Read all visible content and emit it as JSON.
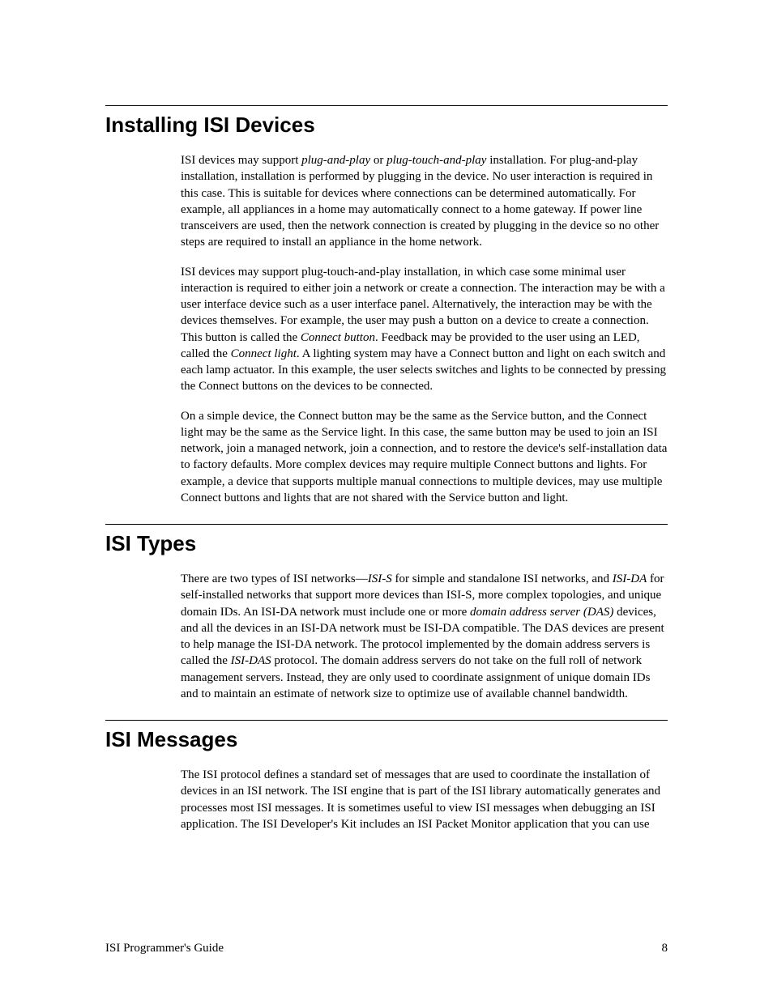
{
  "sections": {
    "installing": {
      "heading": "Installing ISI Devices",
      "p1a": "ISI devices may support ",
      "p1_it1": "plug-and-play",
      "p1b": " or ",
      "p1_it2": "plug-touch-and-play",
      "p1c": " installation.  For plug-and-play installation, installation is performed by plugging in the device.  No user interaction is required in this case.  This is suitable for devices where connections can be determined automatically.  For example, all appliances in a home may automatically connect to a home gateway.  If power line transceivers are used, then the network connection is created by plugging in the device so no other steps are required to install an appliance in the home network.",
      "p2a": "ISI devices may support plug-touch-and-play installation, in which case some minimal user interaction is required to either join a network or create a connection.  The interaction may be with a user interface device such as a user interface panel.  Alternatively, the interaction may be with the devices themselves.  For example, the user may push a button on a device to create a connection.  This button is called the ",
      "p2_it1": "Connect button",
      "p2b": ".  Feedback may be provided to the user using an LED, called the ",
      "p2_it2": "Connect light",
      "p2c": ".  A lighting system may have a Connect button and light on each switch and each lamp actuator.  In this example, the user selects switches and lights to be connected by pressing the Connect buttons on the devices to be connected.",
      "p3": "On a simple device, the Connect button may be the same as the Service button, and the Connect light may be the same as the Service light.  In this case, the same button may be used to join an ISI network, join a managed network, join a connection, and to restore the device's self-installation data to factory defaults.  More complex devices may require multiple Connect buttons and lights.  For example, a device that supports multiple manual connections to multiple devices, may use multiple Connect buttons and lights that are not shared with the Service button and light."
    },
    "types": {
      "heading": "ISI Types",
      "p1a": "There are two types of ISI networks—",
      "p1_it1": "ISI-S",
      "p1b": " for simple and standalone ISI networks, and ",
      "p1_it2": "ISI-DA",
      "p1c": " for self-installed networks that support more devices than ISI-S, more complex topologies, and unique domain IDs.  An ISI-DA network must include one or more ",
      "p1_it3": "domain address server (DAS)",
      "p1d": " devices, and all the devices in an ISI-DA network must be ISI-DA compatible.  The DAS devices are present to help manage the ISI-DA network.  The protocol implemented by the domain address servers is called the ",
      "p1_it4": "ISI-DAS",
      "p1e": " protocol.  The domain address servers do not take on the full roll of network management servers.  Instead, they are only used to coordinate assignment of unique domain IDs and to maintain an estimate of network size to optimize use of available channel bandwidth."
    },
    "messages": {
      "heading": "ISI Messages",
      "p1": "The ISI protocol defines a standard set of messages that are used to coordinate the installation of devices in an ISI network.  The ISI engine that is part of the ISI library automatically generates and processes most ISI messages.  It is sometimes useful to view ISI messages when debugging an ISI application.  The ISI Developer's Kit includes an ISI Packet Monitor application that you can use"
    }
  },
  "footer": {
    "left": "ISI Programmer's Guide",
    "right": "8"
  }
}
